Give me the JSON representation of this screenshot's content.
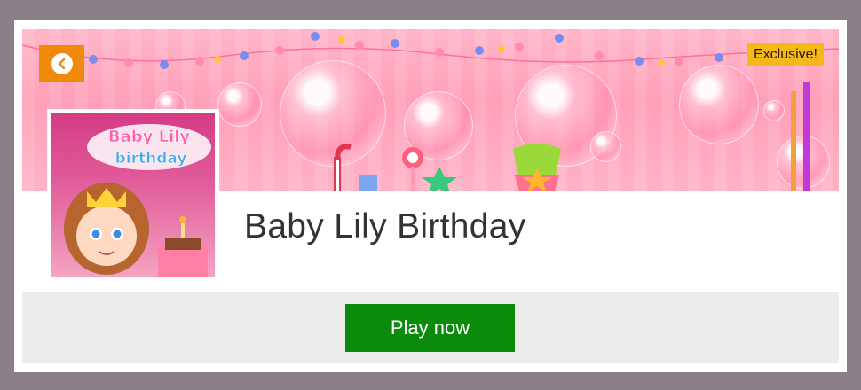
{
  "game": {
    "title": "Baby Lily Birthday",
    "badge": "Exclusive!",
    "thumbnail_text": [
      "Baby Lily",
      "birthday"
    ]
  },
  "actions": {
    "back_icon": "chevron-left-icon",
    "play_label": "Play now"
  },
  "colors": {
    "page_background": "#8a7f87",
    "back_button": "#f08a0c",
    "badge": "#f5b819",
    "play_button": "#0c8a0c",
    "play_bar": "#ececec",
    "title_text": "#333333"
  }
}
